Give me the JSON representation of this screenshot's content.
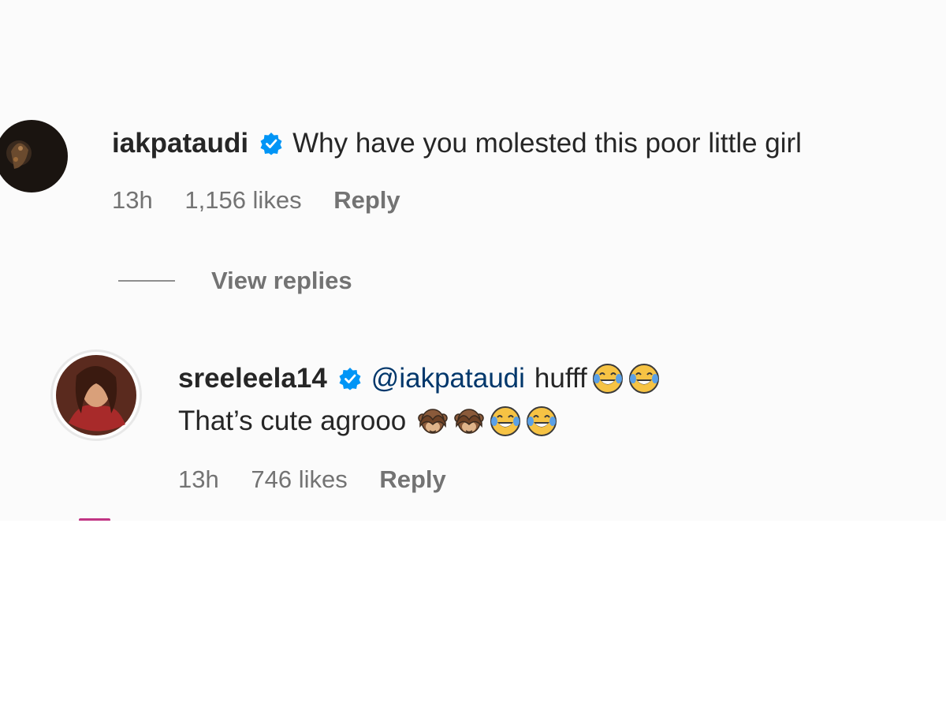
{
  "comments": [
    {
      "username": "iakpataudi",
      "verified": true,
      "text": "Why have you molested this poor little girl",
      "time": "13h",
      "likes": "1,156 likes",
      "reply_label": "Reply",
      "avatar_icon": "profile-photo"
    }
  ],
  "view_replies_label": "View replies",
  "reply": {
    "username": "sreeleela14",
    "verified": true,
    "mention": "@iakpataudi",
    "text_line1": "hufff",
    "text_line2": "That’s cute agrooo",
    "emojis_line1": [
      "face-with-tears-of-joy",
      "face-with-tears-of-joy"
    ],
    "emojis_line2": [
      "see-no-evil-monkey",
      "see-no-evil-monkey",
      "face-with-tears-of-joy",
      "face-with-tears-of-joy"
    ],
    "time": "13h",
    "likes": "746 likes",
    "reply_label": "Reply"
  },
  "colors": {
    "verified_blue": "#0095f6",
    "mention_blue": "#00376b",
    "meta_gray": "#737373"
  }
}
